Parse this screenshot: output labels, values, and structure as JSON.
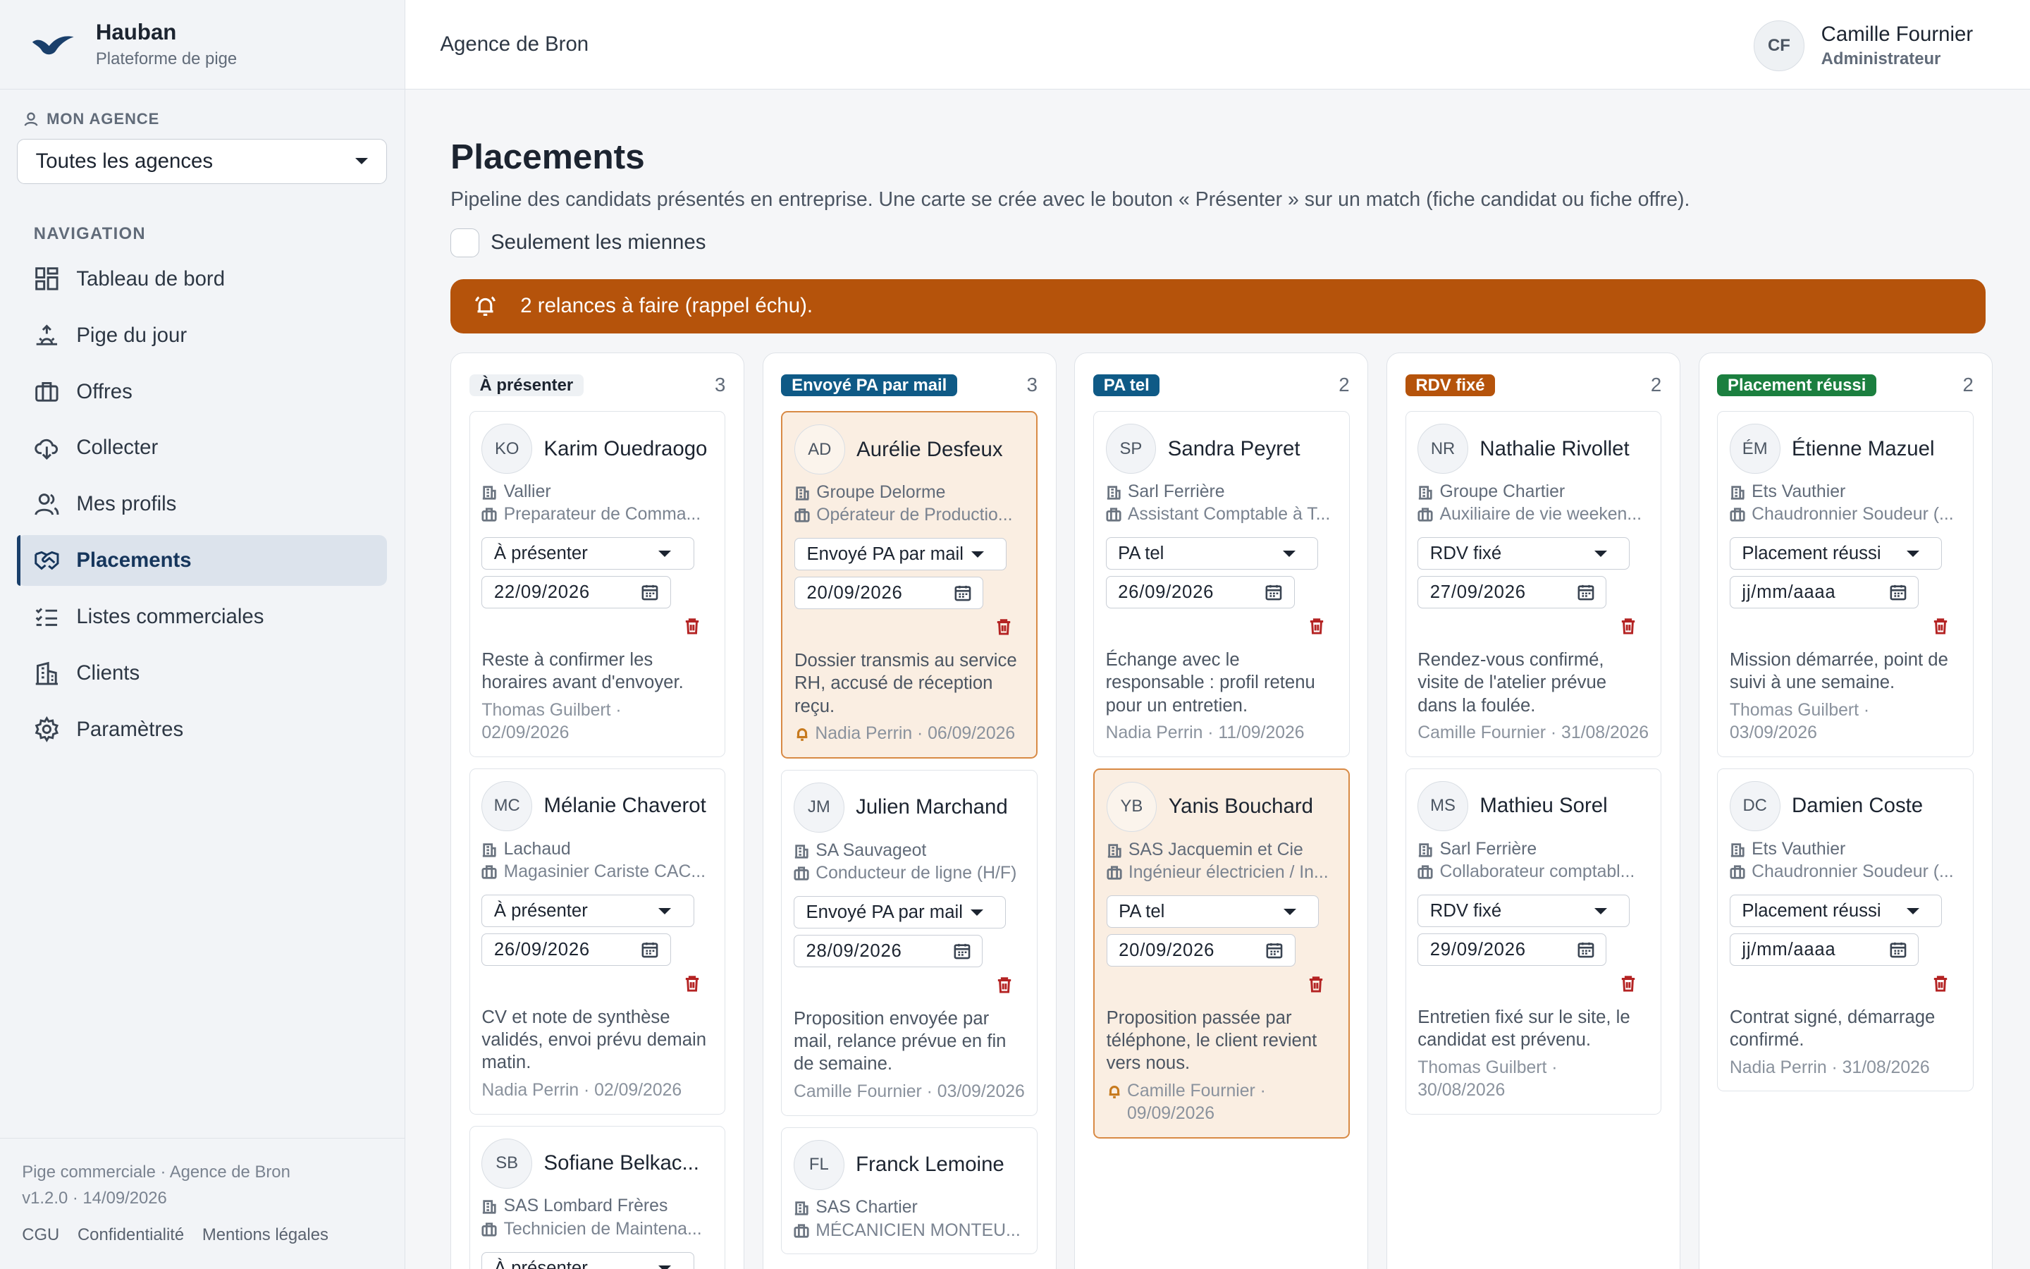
{
  "brand": {
    "name": "Hauban",
    "subtitle": "Plateforme de pige"
  },
  "topbar": {
    "title": "Agence de Bron"
  },
  "user": {
    "initials": "CF",
    "name": "Camille Fournier",
    "role": "Administrateur"
  },
  "agency": {
    "label": "MON AGENCE",
    "selected": "Toutes les agences"
  },
  "nav": {
    "title": "NAVIGATION",
    "items": [
      {
        "label": "Tableau de bord",
        "icon": "dashboard-icon"
      },
      {
        "label": "Pige du jour",
        "icon": "sunrise-icon"
      },
      {
        "label": "Offres",
        "icon": "briefcase-icon"
      },
      {
        "label": "Collecter",
        "icon": "cloud-download-icon"
      },
      {
        "label": "Mes profils",
        "icon": "users-icon"
      },
      {
        "label": "Placements",
        "icon": "handshake-icon",
        "active": true
      },
      {
        "label": "Listes commerciales",
        "icon": "checklist-icon"
      },
      {
        "label": "Clients",
        "icon": "building-icon"
      },
      {
        "label": "Paramètres",
        "icon": "gear-icon"
      }
    ]
  },
  "footer": {
    "line1": "Pige commerciale · Agence de Bron",
    "line2": "v1.2.0 · 14/09/2026",
    "links": [
      "CGU",
      "Confidentialité",
      "Mentions légales"
    ]
  },
  "page": {
    "title": "Placements",
    "description": "Pipeline des candidats présentés en entreprise. Une carte se crée avec le bouton « Présenter » sur un match (fiche candidat ou fiche offre).",
    "only_mine": "Seulement les miennes",
    "alert": "2 relances à faire (rappel échu)."
  },
  "colors": {
    "accent": "#1a3f6b",
    "alert": "#b5530b",
    "danger": "#b42323",
    "highlight_bg": "#faeee2"
  },
  "columns": [
    {
      "title": "À présenter",
      "count": "3",
      "badge_bg": "#eef1f4",
      "badge_fg": "#1c2430",
      "cards": [
        {
          "initials": "KO",
          "name": "Karim Ouedraogo",
          "company": "Vallier",
          "job": "Preparateur de Comma...",
          "stage": "À présenter",
          "date": "22/09/2026",
          "note": "Reste à confirmer les horaires avant d'envoyer.",
          "author": "Thomas Guilbert · 02/09/2026"
        },
        {
          "initials": "MC",
          "name": "Mélanie Chaverot",
          "company": "Lachaud",
          "job": "Magasinier Cariste CAC...",
          "stage": "À présenter",
          "date": "26/09/2026",
          "note": "CV et note de synthèse validés, envoi prévu demain matin.",
          "author": "Nadia Perrin · 02/09/2026"
        },
        {
          "initials": "SB",
          "name": "Sofiane Belkac...",
          "company": "SAS Lombard Frères",
          "job": "Technicien de Maintena...",
          "stage": "À présenter",
          "date": "",
          "note": "",
          "author": ""
        }
      ]
    },
    {
      "title": "Envoyé PA par mail",
      "count": "3",
      "badge_bg": "#0f5a86",
      "badge_fg": "#ffffff",
      "cards": [
        {
          "initials": "AD",
          "name": "Aurélie Desfeux",
          "company": "Groupe Delorme",
          "job": "Opérateur de Productio...",
          "stage": "Envoyé PA par mail",
          "date": "20/09/2026",
          "note": "Dossier transmis au service RH, accusé de réception reçu.",
          "author": "Nadia Perrin · 06/09/2026",
          "highlight": true
        },
        {
          "initials": "JM",
          "name": "Julien Marchand",
          "company": "SA Sauvageot",
          "job": "Conducteur de ligne (H/F)",
          "stage": "Envoyé PA par mail",
          "date": "28/09/2026",
          "note": "Proposition envoyée par mail, relance prévue en fin de semaine.",
          "author": "Camille Fournier · 03/09/2026"
        },
        {
          "initials": "FL",
          "name": "Franck Lemoine",
          "company": "SAS Chartier",
          "job": "MÉCANICIEN MONTEU...",
          "stage": "",
          "date": "",
          "note": "",
          "author": ""
        }
      ]
    },
    {
      "title": "PA tel",
      "count": "2",
      "badge_bg": "#0f5a86",
      "badge_fg": "#ffffff",
      "cards": [
        {
          "initials": "SP",
          "name": "Sandra Peyret",
          "company": "Sarl Ferrière",
          "job": "Assistant Comptable à T...",
          "stage": "PA tel",
          "date": "26/09/2026",
          "note": "Échange avec le responsable : profil retenu pour un entretien.",
          "author": "Nadia Perrin · 11/09/2026"
        },
        {
          "initials": "YB",
          "name": "Yanis Bouchard",
          "company": "SAS Jacquemin et Cie",
          "job": "Ingénieur électricien / In...",
          "stage": "PA tel",
          "date": "20/09/2026",
          "note": "Proposition passée par téléphone, le client revient vers nous.",
          "author": "Camille Fournier · 09/09/2026",
          "highlight": true
        }
      ]
    },
    {
      "title": "RDV fixé",
      "count": "2",
      "badge_bg": "#b5530b",
      "badge_fg": "#ffffff",
      "cards": [
        {
          "initials": "NR",
          "name": "Nathalie Rivollet",
          "company": "Groupe Chartier",
          "job": "Auxiliaire de vie weeken...",
          "stage": "RDV fixé",
          "date": "27/09/2026",
          "note": "Rendez-vous confirmé, visite de l'atelier prévue dans la foulée.",
          "author": "Camille Fournier · 31/08/2026"
        },
        {
          "initials": "MS",
          "name": "Mathieu Sorel",
          "company": "Sarl Ferrière",
          "job": "Collaborateur comptabl...",
          "stage": "RDV fixé",
          "date": "29/09/2026",
          "note": "Entretien fixé sur le site, le candidat est prévenu.",
          "author": "Thomas Guilbert · 30/08/2026"
        }
      ]
    },
    {
      "title": "Placement réussi",
      "count": "2",
      "badge_bg": "#1b7f3f",
      "badge_fg": "#ffffff",
      "cards": [
        {
          "initials": "ÉM",
          "name": "Étienne Mazuel",
          "company": "Ets Vauthier",
          "job": "Chaudronnier Soudeur (...",
          "stage": "Placement réussi",
          "date": "jj/mm/aaaa",
          "note": "Mission démarrée, point de suivi à une semaine.",
          "author": "Thomas Guilbert · 03/09/2026"
        },
        {
          "initials": "DC",
          "name": "Damien Coste",
          "company": "Ets Vauthier",
          "job": "Chaudronnier Soudeur (...",
          "stage": "Placement réussi",
          "date": "jj/mm/aaaa",
          "note": "Contrat signé, démarrage confirmé.",
          "author": "Nadia Perrin · 31/08/2026"
        }
      ]
    }
  ]
}
